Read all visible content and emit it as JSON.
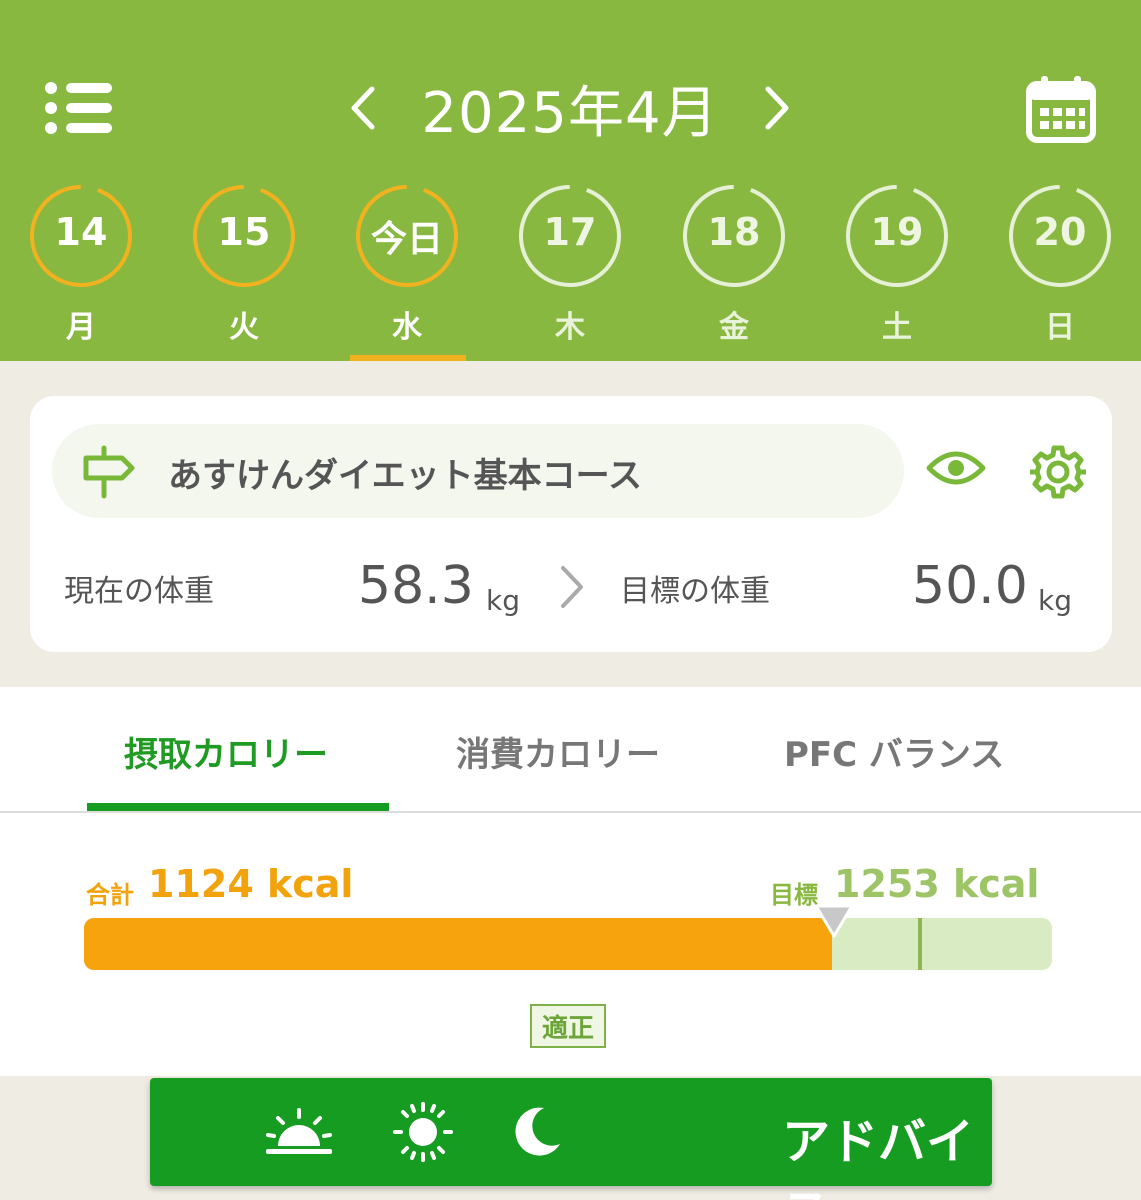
{
  "header": {
    "month_title": "2025年4月",
    "days": [
      {
        "label": "14",
        "weekday": "月",
        "state": "past"
      },
      {
        "label": "15",
        "weekday": "火",
        "state": "past"
      },
      {
        "label": "今日",
        "weekday": "水",
        "state": "today"
      },
      {
        "label": "17",
        "weekday": "木",
        "state": "future"
      },
      {
        "label": "18",
        "weekday": "金",
        "state": "future"
      },
      {
        "label": "19",
        "weekday": "土",
        "state": "future"
      },
      {
        "label": "20",
        "weekday": "日",
        "state": "future"
      }
    ],
    "icons": {
      "menu": "list-icon",
      "calendar": "calendar-icon",
      "prev": "chevron-left-icon",
      "next": "chevron-right-icon"
    }
  },
  "course": {
    "name": "あすけんダイエット基本コース",
    "current_weight_label": "現在の体重",
    "current_weight_value": "58.3",
    "current_weight_unit": "kg",
    "target_weight_label": "目標の体重",
    "target_weight_value": "50.0",
    "target_weight_unit": "kg"
  },
  "tabs": [
    {
      "label": "摂取カロリー",
      "active": true
    },
    {
      "label": "消費カロリー",
      "active": false
    },
    {
      "label": "PFC バランス",
      "active": false
    }
  ],
  "calories": {
    "total_label": "合計",
    "total_value": "1124 kcal",
    "target_label": "目標",
    "target_value": "1253 kcal",
    "fill_fraction": 0.773,
    "status": "適正"
  },
  "advice": {
    "label": "アドバイス",
    "icons": [
      "sunrise-icon",
      "sun-icon",
      "moon-icon"
    ]
  },
  "colors": {
    "header_green": "#89b840",
    "accent_orange": "#f6a30d",
    "active_tab_green": "#1f9a22",
    "button_green": "#179c22"
  }
}
